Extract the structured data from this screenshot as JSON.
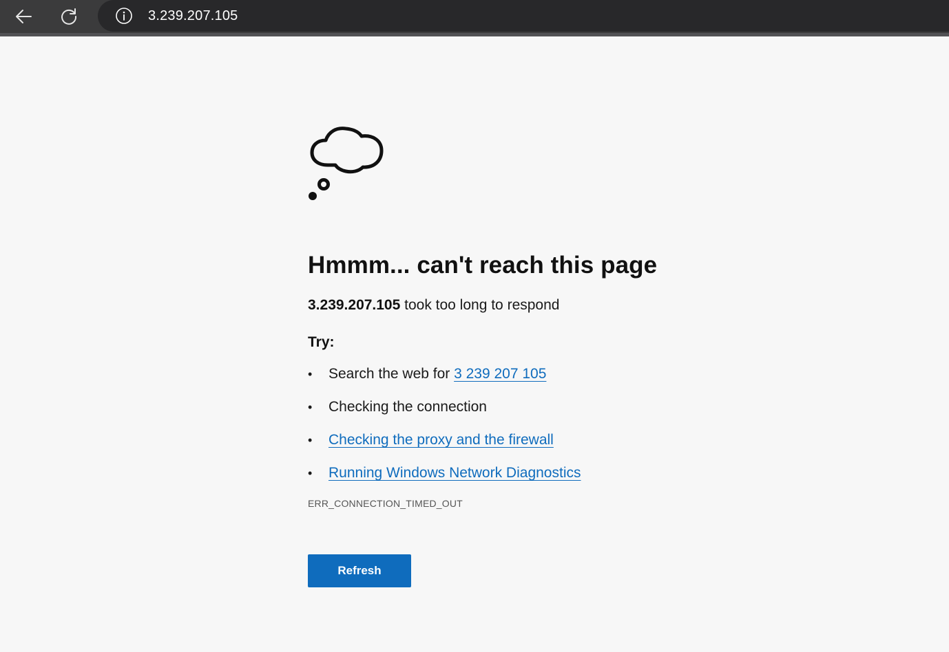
{
  "browser": {
    "url": "3.239.207.105",
    "icons": {
      "back": "back-arrow-icon",
      "reload": "reload-icon",
      "site_info": "info-icon"
    }
  },
  "error_page": {
    "icon": "thought-cloud-icon",
    "heading": "Hmmm... can't reach this page",
    "host": "3.239.207.105",
    "message_suffix": " took too long to respond",
    "try_label": "Try:",
    "suggestions": [
      {
        "prefix": "Search the web for ",
        "link": "3 239 207 105"
      },
      {
        "text": "Checking the connection"
      },
      {
        "link": "Checking the proxy and the firewall"
      },
      {
        "link": "Running Windows Network Diagnostics"
      }
    ],
    "error_code": "ERR_CONNECTION_TIMED_OUT",
    "refresh_label": "Refresh"
  },
  "colors": {
    "page_background": "#f7f7f7",
    "toolbar": "#3b3b3c",
    "address_bar": "#28282a",
    "link": "#0f6cbd",
    "button": "#0f6cbd"
  }
}
